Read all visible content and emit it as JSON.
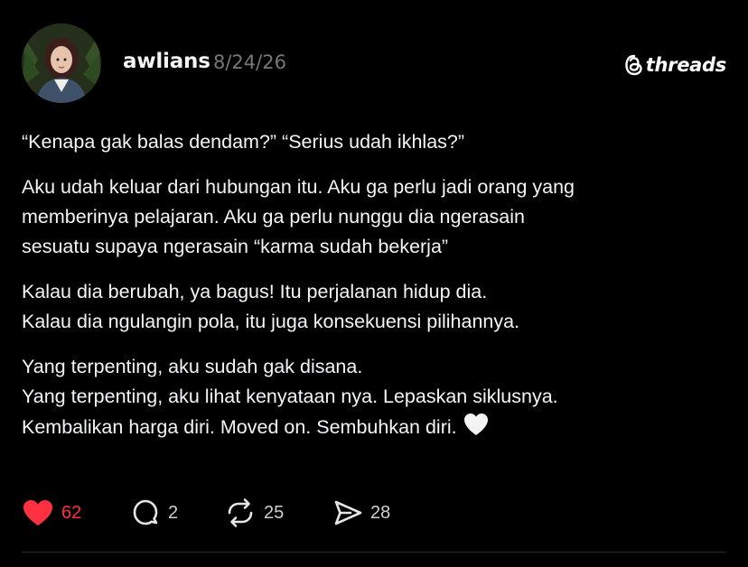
{
  "post": {
    "username": "awlians",
    "date": "8/24/26",
    "brand": "threads",
    "paragraphs": [
      [
        "“Kenapa gak balas dendam?” “Serius udah ikhlas?”"
      ],
      [
        "Aku udah keluar dari hubungan itu. Aku ga perlu jadi orang yang",
        "memberinya pelajaran. Aku ga perlu nunggu dia ngerasain",
        "sesuatu supaya ngerasain “karma sudah bekerja”"
      ],
      [
        "Kalau dia berubah, ya bagus! Itu perjalanan hidup dia.",
        "Kalau dia ngulangin pola, itu juga konsekuensi pilihannya."
      ],
      [
        "Yang terpenting, aku sudah gak disana.",
        "Yang terpenting, aku lihat kenyataan nya. Lepaskan siklusnya.",
        "Kembalikan harga diri. Moved on. Sembuhkan diri."
      ]
    ],
    "trailing_emoji": "white-heart-icon"
  },
  "actions": {
    "likes": "62",
    "comments": "2",
    "reposts": "25",
    "shares": "28"
  },
  "colors": {
    "background": "#000000",
    "text": "#f3f5f7",
    "muted": "#777777",
    "like": "#ff3040"
  }
}
